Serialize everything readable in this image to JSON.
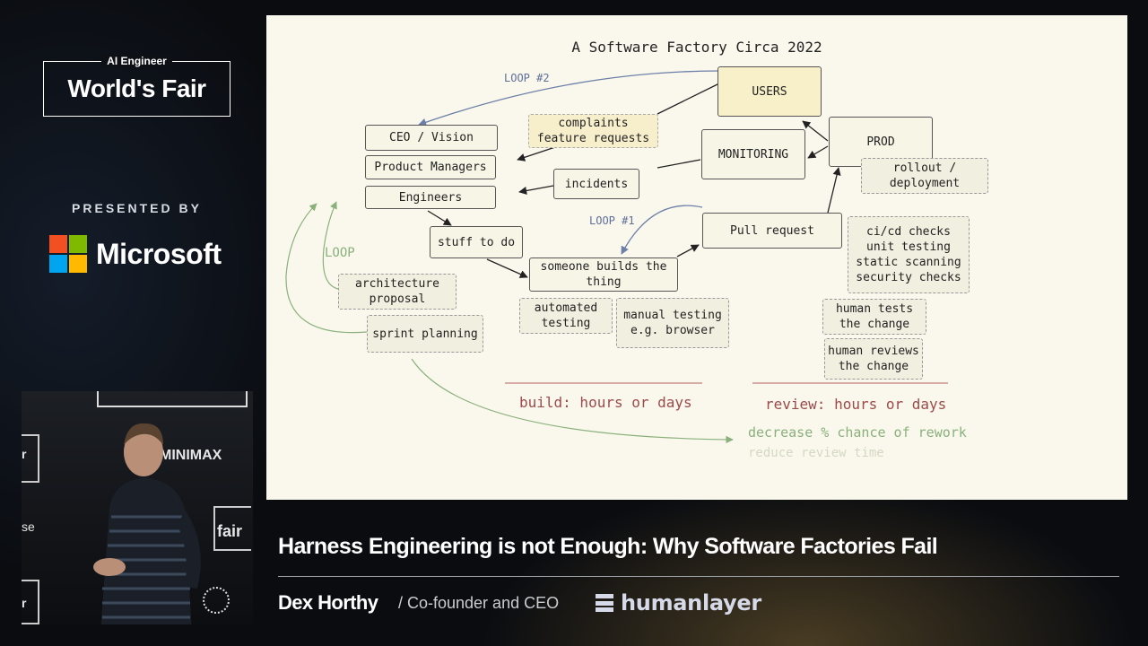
{
  "brand": {
    "small": "AI Engineer",
    "big": "World's Fair"
  },
  "presented_by": "PRESENTED BY",
  "sponsor": {
    "name": "Microsoft",
    "colors": [
      "#f25022",
      "#7fba00",
      "#00a4ef",
      "#ffb900"
    ]
  },
  "video": {
    "sign_minimax": "MINIMAX",
    "sign_fair": "fair",
    "sign_r1": "r",
    "sign_r2": "r",
    "sign_se": "se",
    "icon": "speaker-video"
  },
  "slide": {
    "title": "A Software Factory Circa 2022",
    "nodes": {
      "users": "USERS",
      "prod": "PROD",
      "monitoring": "MONITORING",
      "rollout": "rollout /\ndeployment",
      "complaints": "complaints\nfeature requests",
      "ceo": "CEO / Vision",
      "pm": "Product Managers",
      "engineers": "Engineers",
      "incidents": "incidents",
      "stuff": "stuff to do",
      "pull_request": "Pull request",
      "cicd": "ci/cd checks\nunit testing\nstatic scanning\nsecurity checks",
      "someone_builds": "someone builds the\nthing",
      "automated": "automated\ntesting",
      "manual": "manual testing\ne.g. browser",
      "arch": "architecture\nproposal",
      "sprint": "sprint planning",
      "human_tests": "human tests\nthe change",
      "human_reviews": "human reviews\nthe change"
    },
    "labels": {
      "loop2": "LOOP #2",
      "loop1": "LOOP #1",
      "loop": "LOOP",
      "build": "build: hours or days",
      "review": "review: hours or days",
      "decrease": "decrease % chance of rework",
      "reduce": "reduce review time"
    }
  },
  "talk": {
    "title": "Harness Engineering is not Enough: Why Software Factories Fail",
    "speaker": "Dex Horthy",
    "role": "/ Co-founder and CEO",
    "company": "humanlayer"
  }
}
